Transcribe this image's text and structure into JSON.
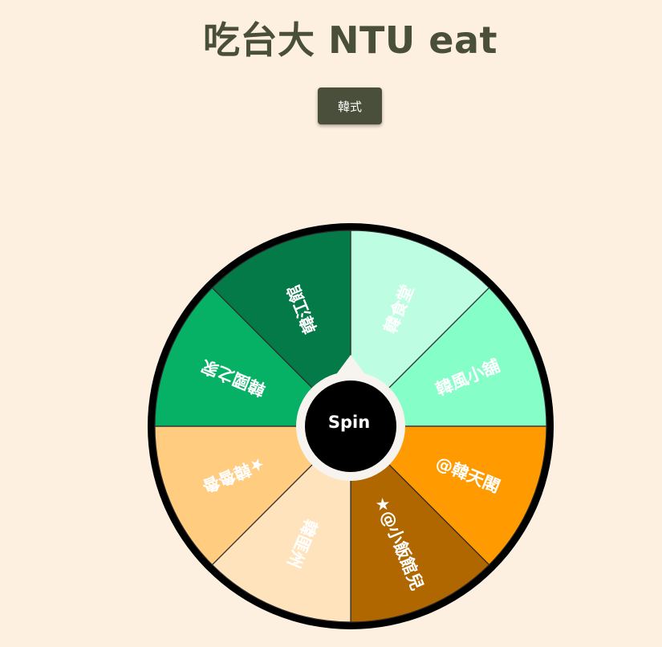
{
  "header": {
    "title": "吃台大 NTU eat"
  },
  "category_button": {
    "label": "韓式"
  },
  "wheel": {
    "spin_label": "Spin",
    "rim_color": "#000000",
    "segments": [
      {
        "label": "韓食堂",
        "color": "#bdfee2"
      },
      {
        "label": "韓風小舖",
        "color": "#85fec8"
      },
      {
        "label": "@韓天閣",
        "color": "#ff9a00"
      },
      {
        "label": "★@小飯館兒",
        "color": "#b06700"
      },
      {
        "label": "韓匪州",
        "color": "#ffe3bd"
      },
      {
        "label": "★韓魯魯",
        "color": "#ffcc80"
      },
      {
        "label": "韓國之家",
        "color": "#06b166"
      },
      {
        "label": "韓江館",
        "color": "#037a47"
      }
    ]
  }
}
